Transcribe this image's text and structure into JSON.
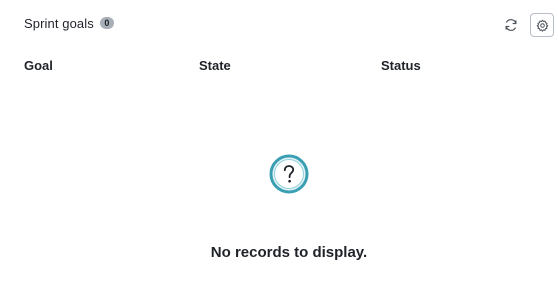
{
  "panel": {
    "title": "Sprint goals",
    "count": "0"
  },
  "toolbar": {
    "refresh_icon": "refresh-icon",
    "settings_icon": "gear-icon"
  },
  "table": {
    "columns": [
      "Goal",
      "State",
      "Status"
    ]
  },
  "empty_state": {
    "icon": "question-icon",
    "message": "No records to display.",
    "accent_color": "#3b9fb3"
  }
}
